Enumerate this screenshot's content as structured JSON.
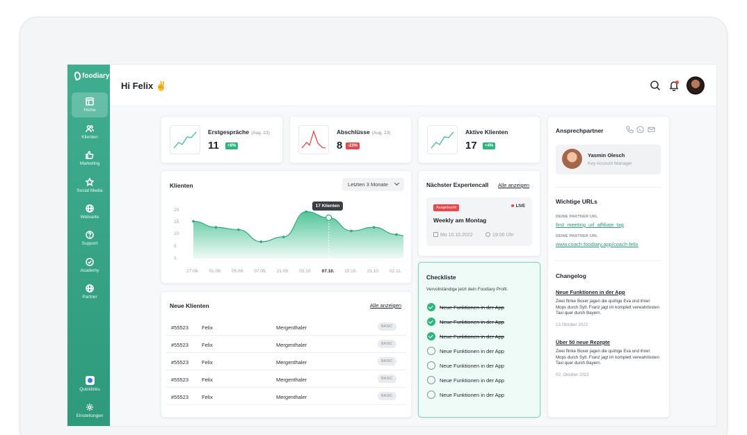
{
  "header": {
    "greeting": "Hi Felix ✌️"
  },
  "sidebar": {
    "logo": "foodiary",
    "items": [
      {
        "label": "Home",
        "icon": "layout-icon"
      },
      {
        "label": "Klienten",
        "icon": "users-icon"
      },
      {
        "label": "Marketing",
        "icon": "thumbs-up-icon"
      },
      {
        "label": "Social Media",
        "icon": "star-icon"
      },
      {
        "label": "Webseite",
        "icon": "globe-icon"
      },
      {
        "label": "Support",
        "icon": "help-icon"
      },
      {
        "label": "Academy",
        "icon": "check-circle-icon"
      },
      {
        "label": "Partner",
        "icon": "globe-icon"
      }
    ],
    "bottom": [
      {
        "label": "Quicklinks",
        "icon": "quicklinks-icon"
      },
      {
        "label": "Einstellungen",
        "icon": "gear-icon"
      }
    ]
  },
  "kpis": [
    {
      "title": "Erstgespräche",
      "period": "(Aug. 23)",
      "value": "11",
      "badge": "+8%",
      "trend": "up"
    },
    {
      "title": "Abschlüsse",
      "period": "(Aug. 23)",
      "value": "8",
      "badge": "-23%",
      "trend": "down"
    },
    {
      "title": "Aktive Klienten",
      "period": "",
      "value": "17",
      "badge": "+4%",
      "trend": "up"
    }
  ],
  "klienten_chart": {
    "title": "Klienten",
    "range_label": "Letzten 3 Monate",
    "tooltip": "17 Klienten"
  },
  "chart_data": {
    "type": "area",
    "x": [
      "27.08.",
      "01.09.",
      "05.09.",
      "07.09.",
      "21.09.",
      "03.10.",
      "07.10.",
      "15.10.",
      "23.10.",
      "02.11."
    ],
    "values": [
      15.5,
      13,
      12,
      7,
      9,
      19.5,
      17,
      11.5,
      13,
      10
    ],
    "extra_point_end": 9.5,
    "y_ticks": [
      0,
      5,
      10,
      15,
      20
    ],
    "y_tick_labels": [
      "1",
      "5",
      "10",
      "15",
      "20"
    ],
    "ylim": [
      0,
      22
    ],
    "highlight_index": 6,
    "color": "#3fbf8f"
  },
  "neue_klienten": {
    "title": "Neue Klienten",
    "link": "Alle anzeigen",
    "rows": [
      {
        "id": "#55523",
        "first": "Felix",
        "last": "Mergenthaler",
        "plan": "BASIC"
      },
      {
        "id": "#55523",
        "first": "Felix",
        "last": "Mergenthaler",
        "plan": "BASIC"
      },
      {
        "id": "#55523",
        "first": "Felix",
        "last": "Mergenthaler",
        "plan": "BASIC"
      },
      {
        "id": "#55523",
        "first": "Felix",
        "last": "Mergenthaler",
        "plan": "BASIC"
      },
      {
        "id": "#55523",
        "first": "Felix",
        "last": "Mergenthaler",
        "plan": "BASIC"
      }
    ]
  },
  "expertencall": {
    "title": "Nächster Expertencall",
    "link": "Alle anzeigen",
    "status": "Ausgebucht",
    "live": "LIVE",
    "name": "Weekly am Montag",
    "date": "Mo 10.10.2022",
    "time": "19:00 Uhr"
  },
  "checkliste": {
    "title": "Checkliste",
    "subtitle": "Vervollständige jetzt dein Foodiary Profil.",
    "items": [
      {
        "label": "Neue Funktionen in der App",
        "done": true
      },
      {
        "label": "Neue Funktionen in der App",
        "done": true
      },
      {
        "label": "Neue Funktionen in der App",
        "done": true
      },
      {
        "label": "Neue Funktionen in der App",
        "done": false
      },
      {
        "label": "Neue Funktionen in der App",
        "done": false
      },
      {
        "label": "Neue Funktionen in der App",
        "done": false
      },
      {
        "label": "Neue Funktionen in der App",
        "done": false
      }
    ]
  },
  "partner": {
    "title": "Ansprechpartner",
    "name": "Yasmin Olesch",
    "role": "Key Account Manager",
    "urls_title": "Wichtige URLs",
    "url1_label": "DEINE PARTNER URL",
    "url1": "first_meeting_url_affiliate_tag",
    "url2_label": "DEINE PARTNER URL",
    "url2": "www.coach.foodiary.app/coach-felix",
    "changelog_title": "Changelog",
    "changelog": [
      {
        "title": "Neue Funktionen in der App",
        "text": "Zwei flinke Boxer jagen die quirlige Eva und ihren Mops durch Sylt. Franz jagt im komplett verwahrlosten Taxi quer durch Bayern.",
        "date": "13.Oktober 2022"
      },
      {
        "title": "Über 50 neue Rezepte",
        "text": "Zwei flinke Boxer jagen die quirlige Eva und ihren Mops durch Sylt. Franz jagt im komplett verwahrlosten Taxi quer durch Bayern.",
        "date": "02. Oktober 2022"
      }
    ]
  }
}
